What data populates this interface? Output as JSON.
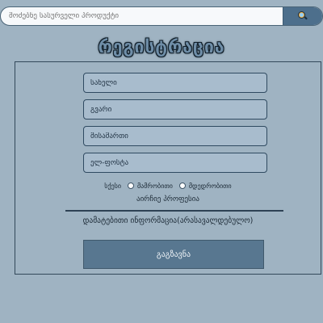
{
  "search": {
    "placeholder": "მოძებნე სასურველი პროდუქტი",
    "button_icon": "search-icon"
  },
  "page": {
    "title": "რეგისტრაცია"
  },
  "form": {
    "fields": {
      "name": "სახელი",
      "surname": "გვარი",
      "address": "მისამართი",
      "email": "ელ-ფოსტა"
    },
    "gender": {
      "label": "სქესი",
      "options": [
        "მამრობითი",
        "მდედრობითი"
      ]
    },
    "profession_label": "აირჩიე პროფესია",
    "additional_info": "დამატებითი ინფორმაცია(არასავალდებულო)",
    "submit": "გაგზავნა"
  },
  "colors": {
    "background": "#9fb3c2",
    "accent": "#4d6f8c",
    "button": "#587790"
  }
}
